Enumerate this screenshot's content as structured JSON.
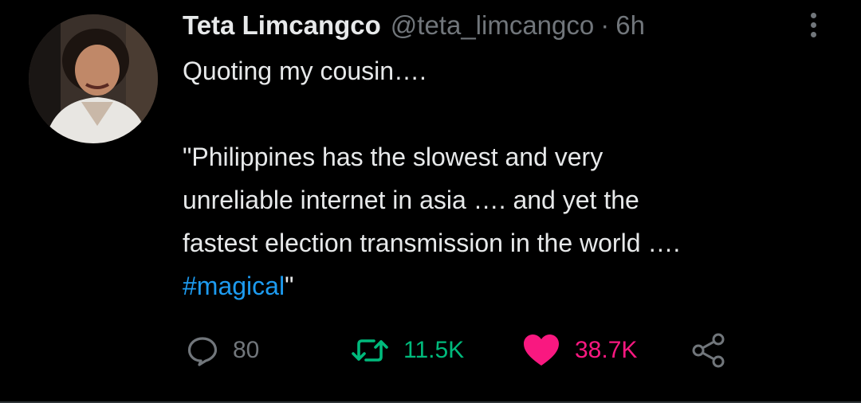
{
  "tweet": {
    "display_name": "Teta Limcangco",
    "handle": "@teta_limcangco",
    "separator": "·",
    "timestamp": "6h",
    "lines": [
      "Quoting my cousin….",
      "\"Philippines has the slowest and very",
      "unreliable internet in asia …. and yet the",
      "fastest election transmission in the world …."
    ],
    "hashtag": "#magical",
    "closing_quote": "\""
  },
  "actions": {
    "replies": "80",
    "retweets": "11.5K",
    "likes": "38.7K"
  },
  "colors": {
    "background": "#000000",
    "text": "#e7e9ea",
    "muted": "#71767b",
    "link": "#1d9bf0",
    "retweet": "#00ba7c",
    "like": "#f91880"
  }
}
